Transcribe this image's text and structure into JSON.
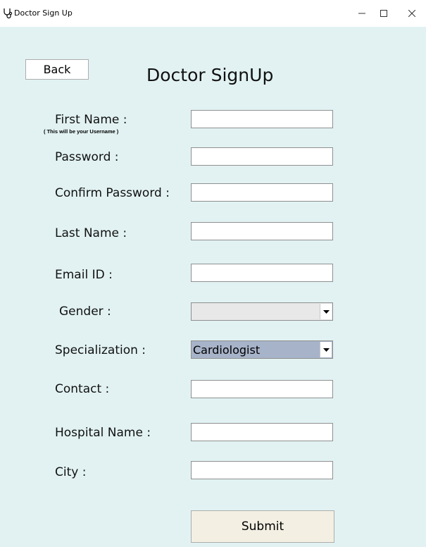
{
  "window": {
    "title": "Doctor Sign Up",
    "app_icon": "stethoscope-icon",
    "controls": [
      "minimize-icon",
      "maximize-icon",
      "close-icon"
    ]
  },
  "header": {
    "back_label": "Back",
    "title": "Doctor SignUp"
  },
  "form": {
    "first_name": {
      "label": "First Name :",
      "hint": "( This will be your Username )",
      "value": ""
    },
    "password": {
      "label": "Password :",
      "value": ""
    },
    "confirm_password": {
      "label": "Confirm Password :",
      "value": ""
    },
    "last_name": {
      "label": "Last Name :",
      "value": ""
    },
    "email": {
      "label": "Email ID :",
      "value": ""
    },
    "gender": {
      "label": "Gender :",
      "selected": ""
    },
    "specialization": {
      "label": "Specialization :",
      "selected": "Cardiologist"
    },
    "contact": {
      "label": "Contact :",
      "value": ""
    },
    "hospital_name": {
      "label": "Hospital Name :",
      "value": ""
    },
    "city": {
      "label": "City :",
      "value": ""
    },
    "submit_label": "Submit"
  },
  "colors": {
    "background": "#e2f2f2",
    "selected_dropdown": "#a7b3c9",
    "submit_button": "#f3f0e3"
  }
}
